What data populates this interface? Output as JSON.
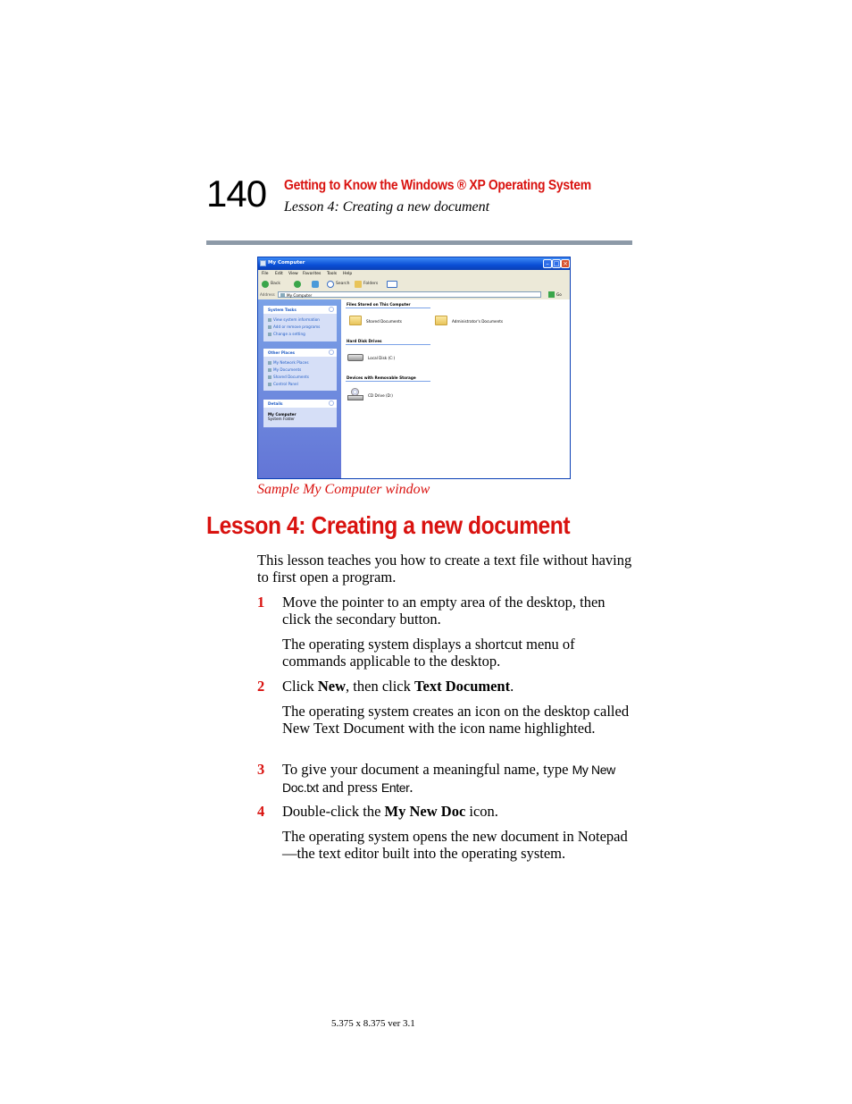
{
  "header": {
    "page_number": "140",
    "chapter_title": "Getting to Know the Windows ® XP Operating System",
    "section_title": "Lesson 4: Creating a new document"
  },
  "screenshot": {
    "window_title": "My Computer",
    "menu": [
      "File",
      "Edit",
      "View",
      "Favorites",
      "Tools",
      "Help"
    ],
    "toolbar": {
      "back": "Back",
      "search": "Search",
      "folders": "Folders"
    },
    "address_label": "Address",
    "address_value": "My Computer",
    "go_label": "Go",
    "system_tasks": {
      "title": "System Tasks",
      "items": [
        "View system information",
        "Add or remove programs",
        "Change a setting"
      ]
    },
    "other_places": {
      "title": "Other Places",
      "items": [
        "My Network Places",
        "My Documents",
        "Shared Documents",
        "Control Panel"
      ]
    },
    "details": {
      "title": "Details",
      "name": "My Computer",
      "type": "System Folder"
    },
    "groups": {
      "files": "Files Stored on This Computer",
      "hard_disks": "Hard Disk Drives",
      "removable": "Devices with Removable Storage"
    },
    "items": {
      "shared_documents": "Shared Documents",
      "admin_documents": "Administrator's Documents",
      "local_disk": "Local Disk (C:)",
      "cd_drive": "CD Drive (D:)"
    },
    "colors": {
      "title_bar": "#0a4fd6",
      "task_pane": "#6f8ce0",
      "accent_red": "#d9120f"
    }
  },
  "caption": "Sample My Computer window",
  "lesson_heading": "Lesson 4: Creating a new document",
  "intro": "This lesson teaches you how to create a text file without having to first open a program.",
  "steps": [
    {
      "num": "1",
      "text": "Move the pointer to an empty area of the desktop, then click the secondary button.",
      "result": "The operating system displays a shortcut menu of commands applicable to the desktop."
    },
    {
      "num": "2",
      "pre": "Click ",
      "bold1": "New",
      "mid": ", then click ",
      "bold2": "Text Document",
      "post": ".",
      "result": "The operating system creates an icon on the desktop called New Text Document with the icon name highlighted."
    },
    {
      "num": "3",
      "pre": "To give your document a meaningful name, type ",
      "code1a": "My New",
      "code1b": "Doc.txt",
      "mid": " and press ",
      "code2": "Enter",
      "post": "."
    },
    {
      "num": "4",
      "pre": "Double-click the ",
      "bold1": "My New Doc",
      "post": " icon.",
      "result": "The operating system opens the new document in Notepad—the text editor built into the operating system."
    }
  ],
  "footer": "5.375 x 8.375 ver 3.1"
}
